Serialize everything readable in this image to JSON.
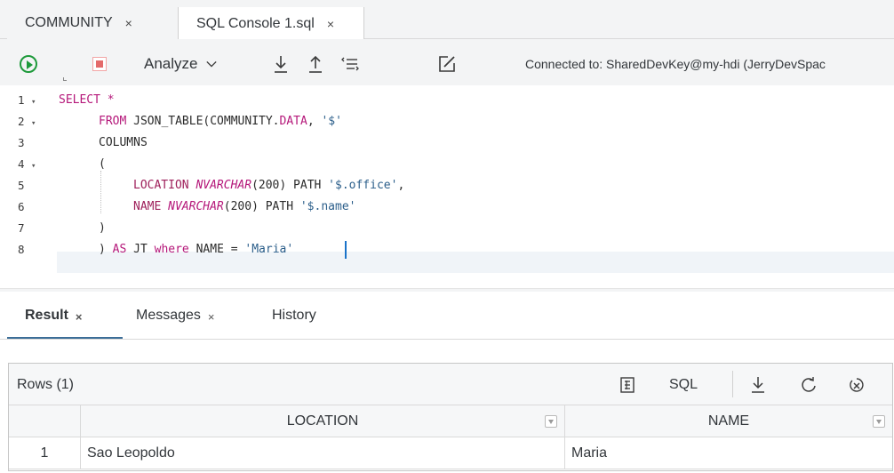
{
  "tabs": [
    {
      "label": "COMMUNITY",
      "close": "×"
    },
    {
      "label": "SQL Console 1.sql",
      "close": "×"
    }
  ],
  "toolbar": {
    "analyze_label": "Analyze",
    "connection_text": "Connected to: SharedDevKey@my-hdi (JerryDevSpac",
    "icons": [
      "run-icon",
      "stop-icon",
      "chevron-down-icon",
      "download-icon",
      "upload-icon",
      "format-icon",
      "edit-icon"
    ]
  },
  "editor": {
    "line_numbers": [
      "1",
      "2",
      "3",
      "4",
      "5",
      "6",
      "7",
      "8"
    ],
    "lines": {
      "l1_kw": "SELECT *",
      "l2_kw": "FROM",
      "l2_fn": " JSON_TABLE(COMMUNITY.",
      "l2_data": "DATA",
      "l2_tail": ", ",
      "l2_str": "'$'",
      "l3": "COLUMNS",
      "l4": "(",
      "l5_col": "LOCATION ",
      "l5_type": "NVARCHAR",
      "l5_mid": "(200) PATH ",
      "l5_str": "'$.office'",
      "l5_end": ",",
      "l6_col": "NAME ",
      "l6_type": "NVARCHAR",
      "l6_mid": "(200) PATH ",
      "l6_str": "'$.name'",
      "l7": ")",
      "l8_a": ") ",
      "l8_as": "AS",
      "l8_b": " JT ",
      "l8_where": "where",
      "l8_c": " NAME = ",
      "l8_str": "'Maria'"
    }
  },
  "result_tabs": [
    {
      "label": "Result",
      "close": "×",
      "active": true
    },
    {
      "label": "Messages",
      "close": "×",
      "active": false
    },
    {
      "label": "History",
      "active": false
    }
  ],
  "result": {
    "rows_label": "Rows (1)",
    "sql_label": "SQL",
    "header_icons": [
      "column-settings-icon",
      "download-icon",
      "refresh-icon",
      "clear-icon"
    ],
    "columns": [
      "LOCATION",
      "NAME"
    ],
    "rows": [
      {
        "num": "1",
        "location": "Sao Leopoldo",
        "name": "Maria"
      }
    ]
  },
  "colors": {
    "keyword": "#b5187a",
    "run": "#1e9a3b",
    "stop": "#e46a6a",
    "caret": "#1a73c9",
    "active_tab_underline": "#3c6e98"
  }
}
